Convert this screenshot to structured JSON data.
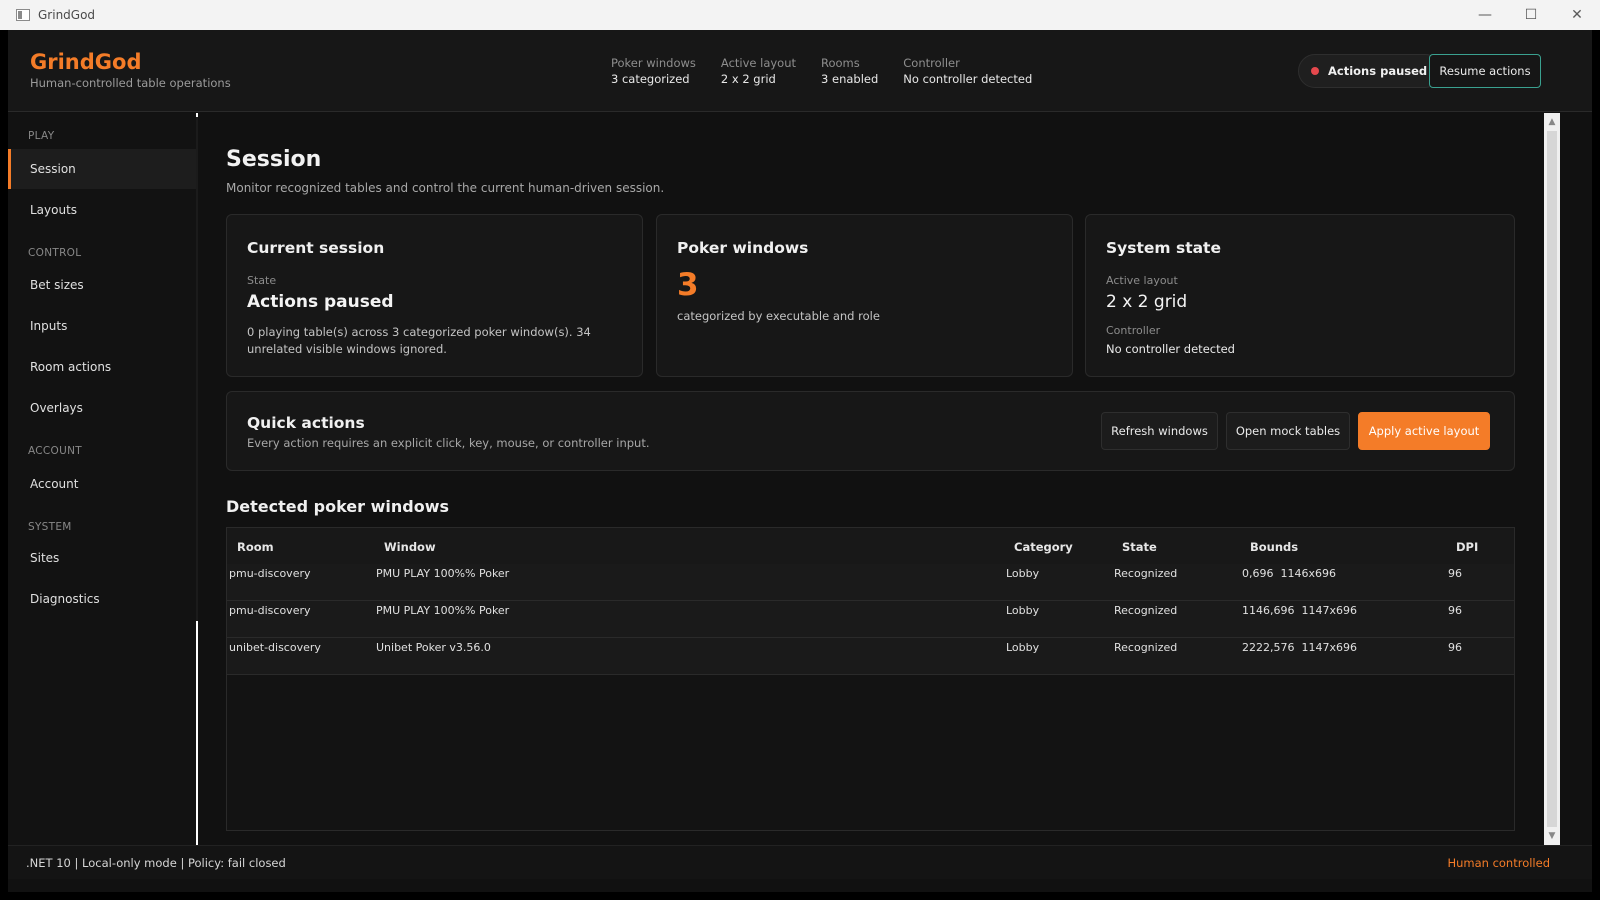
{
  "window": {
    "title": "GrindGod",
    "controls": [
      "—",
      "☐",
      "✕"
    ]
  },
  "header": {
    "brand": "GrindGod",
    "subtitle": "Human-controlled table operations",
    "stats": [
      {
        "label": "Poker windows",
        "value": "3 categorized"
      },
      {
        "label": "Active layout",
        "value": "2 x 2 grid"
      },
      {
        "label": "Rooms",
        "value": "3 enabled"
      },
      {
        "label": "Controller",
        "value": "No controller detected"
      }
    ],
    "status_pill": "Actions paused",
    "resume_button": "Resume actions"
  },
  "sidebar": {
    "sections": [
      "PLAY",
      "CONTROL",
      "ACCOUNT",
      "SYSTEM"
    ],
    "items": [
      {
        "label": "Session",
        "active": true
      },
      {
        "label": "Layouts"
      },
      {
        "label": "Bet sizes"
      },
      {
        "label": "Inputs"
      },
      {
        "label": "Room actions"
      },
      {
        "label": "Overlays"
      },
      {
        "label": "Account"
      },
      {
        "label": "Sites"
      },
      {
        "label": "Diagnostics"
      }
    ]
  },
  "main": {
    "title": "Session",
    "subtitle": "Monitor recognized tables and control the current human-driven session.",
    "current_session": {
      "title": "Current session",
      "state_label": "State",
      "state_value": "Actions paused",
      "description": "0 playing table(s) across 3 categorized poker window(s). 34 unrelated visible windows ignored."
    },
    "poker_windows": {
      "title": "Poker windows",
      "count": "3",
      "caption": "categorized by executable and role"
    },
    "system_state": {
      "title": "System state",
      "layout_label": "Active layout",
      "layout_value": "2 x 2 grid",
      "controller_label": "Controller",
      "controller_value": "No controller detected"
    },
    "quick_actions": {
      "title": "Quick actions",
      "subtitle": "Every action requires an explicit click, key, mouse, or controller input.",
      "refresh": "Refresh windows",
      "open_mock": "Open mock tables",
      "apply_layout": "Apply active layout"
    },
    "detected": {
      "title": "Detected poker windows",
      "columns": [
        "Room",
        "Window",
        "Category",
        "State",
        "Bounds",
        "DPI"
      ],
      "rows": [
        [
          "pmu-discovery",
          "PMU PLAY 100%% Poker",
          "Lobby",
          "Recognized",
          "0,696  1146x696",
          "96"
        ],
        [
          "pmu-discovery",
          "PMU PLAY 100%% Poker",
          "Lobby",
          "Recognized",
          "1146,696  1147x696",
          "96"
        ],
        [
          "unibet-discovery",
          "Unibet Poker v3.56.0",
          "Lobby",
          "Recognized",
          "2222,576  1147x696",
          "96"
        ]
      ]
    }
  },
  "scrollbar": {
    "up": "▲",
    "down": "▼"
  },
  "footer": {
    "left": ".NET 10 | Local-only mode | Policy: fail closed",
    "right": "Human controlled"
  },
  "colors": {
    "accent": "#f47c28",
    "teal_border": "#3aa190",
    "paused_dot": "#e5484d",
    "background": "#111111"
  }
}
